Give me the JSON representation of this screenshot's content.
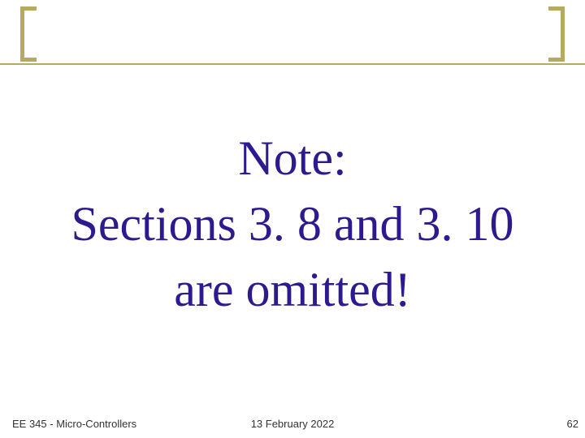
{
  "content": {
    "line1": "Note:",
    "line2": "Sections 3. 8 and 3. 10",
    "line3": "are omitted!"
  },
  "footer": {
    "course": "EE 345 - Micro-Controllers",
    "date": "13 February 2022",
    "page_number": "62"
  },
  "colors": {
    "accent": "#b8a960",
    "text_main": "#2e1a8f"
  }
}
